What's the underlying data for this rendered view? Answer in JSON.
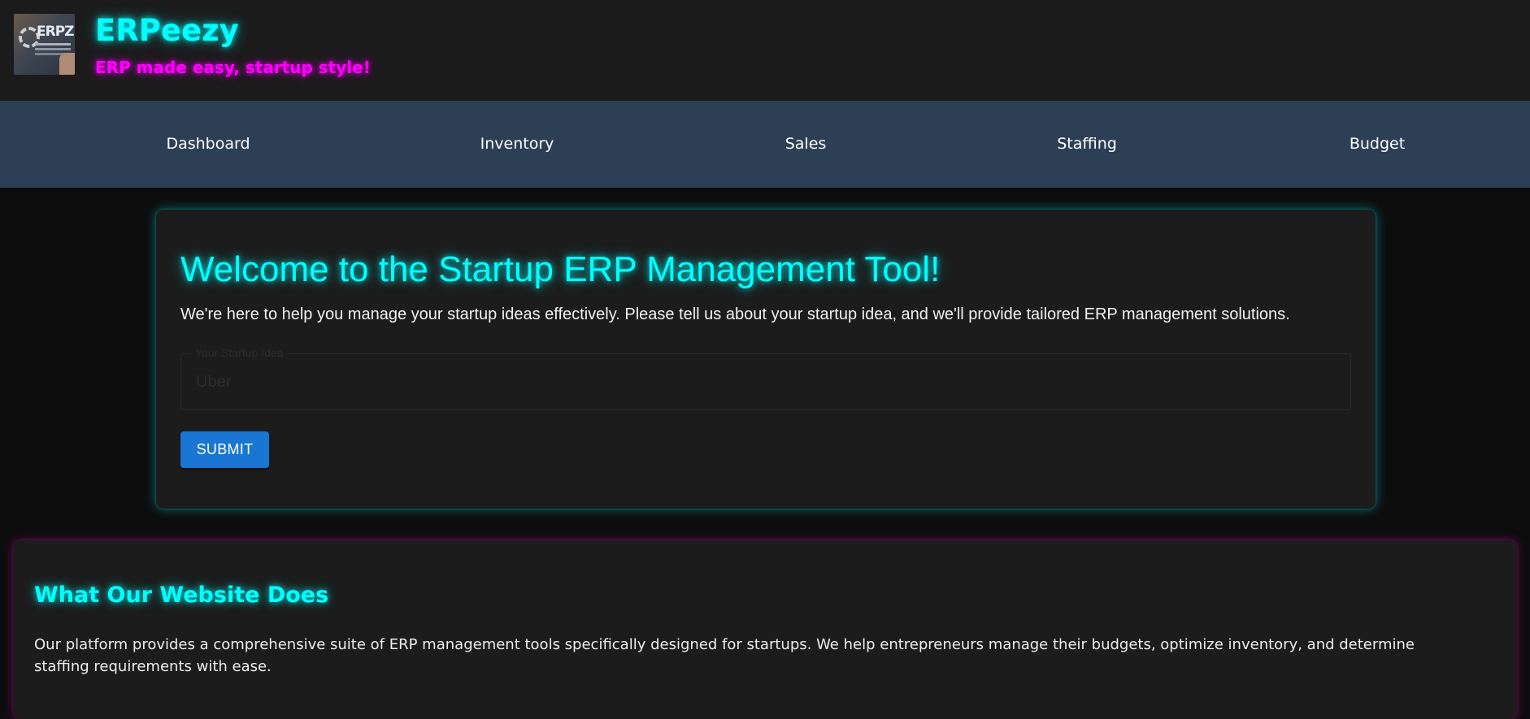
{
  "header": {
    "title": "ERPeezy",
    "tagline": "ERP made easy, startup style!",
    "logo_text": "ERPZ"
  },
  "nav": {
    "items": [
      {
        "label": "Dashboard"
      },
      {
        "label": "Inventory"
      },
      {
        "label": "Sales"
      },
      {
        "label": "Staffing"
      },
      {
        "label": "Budget"
      }
    ]
  },
  "main": {
    "title": "Welcome to the Startup ERP Management Tool!",
    "description": "We're here to help you manage your startup ideas effectively. Please tell us about your startup idea, and we'll provide tailored ERP management solutions.",
    "idea_field": {
      "label": "Your Startup Idea",
      "value": "Uber"
    },
    "submit_label": "SUBMIT"
  },
  "about": {
    "title": "What Our Website Does",
    "text": "Our platform provides a comprehensive suite of ERP management tools specifically designed for startups. We help entrepreneurs manage their budgets, optimize inventory, and determine staffing requirements with ease."
  },
  "colors": {
    "background": "#0d0d0d",
    "header_bg": "#1b1b1b",
    "nav_bg": "#2d3f54",
    "card_bg": "#1c1c1c",
    "accent_cyan": "#00ffff",
    "accent_magenta": "#ff00ff",
    "button_blue": "#1976d2"
  }
}
